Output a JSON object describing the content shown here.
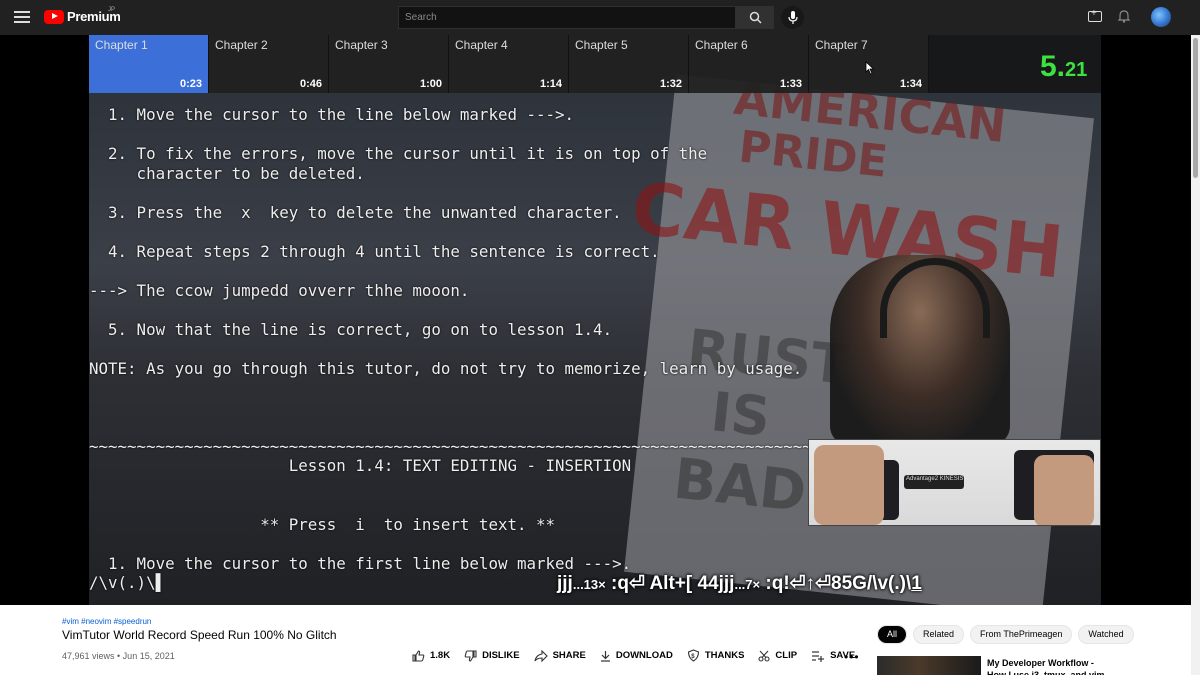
{
  "header": {
    "logo_text": "Premium",
    "logo_region": "JP",
    "search_placeholder": "Search"
  },
  "player": {
    "chapters": [
      {
        "title": "Chapter 1",
        "time": "0:23",
        "active": true
      },
      {
        "title": "Chapter 2",
        "time": "0:46",
        "active": false
      },
      {
        "title": "Chapter 3",
        "time": "1:00",
        "active": false
      },
      {
        "title": "Chapter 4",
        "time": "1:14",
        "active": false
      },
      {
        "title": "Chapter 5",
        "time": "1:32",
        "active": false
      },
      {
        "title": "Chapter 6",
        "time": "1:33",
        "active": false
      },
      {
        "title": "Chapter 7",
        "time": "1:34",
        "active": false
      }
    ],
    "timer_main": "5.",
    "timer_frac": "21",
    "terminal_lines": [
      "  1. Move the cursor to the line below marked --->.",
      "",
      "  2. To fix the errors, move the cursor until it is on top of the",
      "     character to be deleted.",
      "",
      "  3. Press the  x  key to delete the unwanted character.",
      "",
      "  4. Repeat steps 2 through 4 until the sentence is correct.",
      "",
      "---> The ccow jumpedd ovverr thhe mooon.",
      "",
      "  5. Now that the line is correct, go on to lesson 1.4.",
      "",
      "NOTE: As you go through this tutor, do not try to memorize, learn by usage.",
      "",
      "",
      "",
      "~~~~~~~~~~~~~~~~~~~~~~~~~~~~~~~~~~~~~~~~~~~~~~~~~~~~~~~~~~~~~~~~~~~~~~~~~~~~~~",
      "                     Lesson 1.4: TEXT EDITING - INSERTION",
      "",
      "",
      "                  ** Press  i  to insert text. **",
      "",
      "  1. Move the cursor to the first line below marked --->.",
      "/\\v(.)\\▌"
    ],
    "sign_words": [
      "AMERICAN",
      "PRIDE",
      "CAR WASH",
      "RUST",
      "IS",
      "BAD"
    ],
    "keyboard_brand": "Advantage2 KINESIS",
    "keystrokes": {
      "p1": "jjj",
      "m1": "...13×",
      "p2": " :q⏎ Alt+[ 44jjj",
      "m2": "...7×",
      "p3": " :q!⏎↑⏎85G/\\v(.)\\",
      "last": "1"
    }
  },
  "video": {
    "tags": "#vim #neovim #speedrun",
    "title": "VimTutor World Record Speed Run 100% No Glitch",
    "meta": "47,961 views • Jun 15, 2021",
    "actions": [
      {
        "label": "1.8K",
        "icon": "thumbs-up-icon"
      },
      {
        "label": "DISLIKE",
        "icon": "thumbs-down-icon"
      },
      {
        "label": "SHARE",
        "icon": "share-icon"
      },
      {
        "label": "DOWNLOAD",
        "icon": "download-icon"
      },
      {
        "label": "THANKS",
        "icon": "thanks-icon"
      },
      {
        "label": "CLIP",
        "icon": "scissors-icon"
      },
      {
        "label": "SAVE",
        "icon": "playlist-add-icon"
      }
    ],
    "more": "•••"
  },
  "sidebar": {
    "filters": [
      "All",
      "Related",
      "From ThePrimeagen",
      "Watched"
    ],
    "recommendation_title": "My Developer Workflow - How I use i3, tmux, and vim"
  }
}
